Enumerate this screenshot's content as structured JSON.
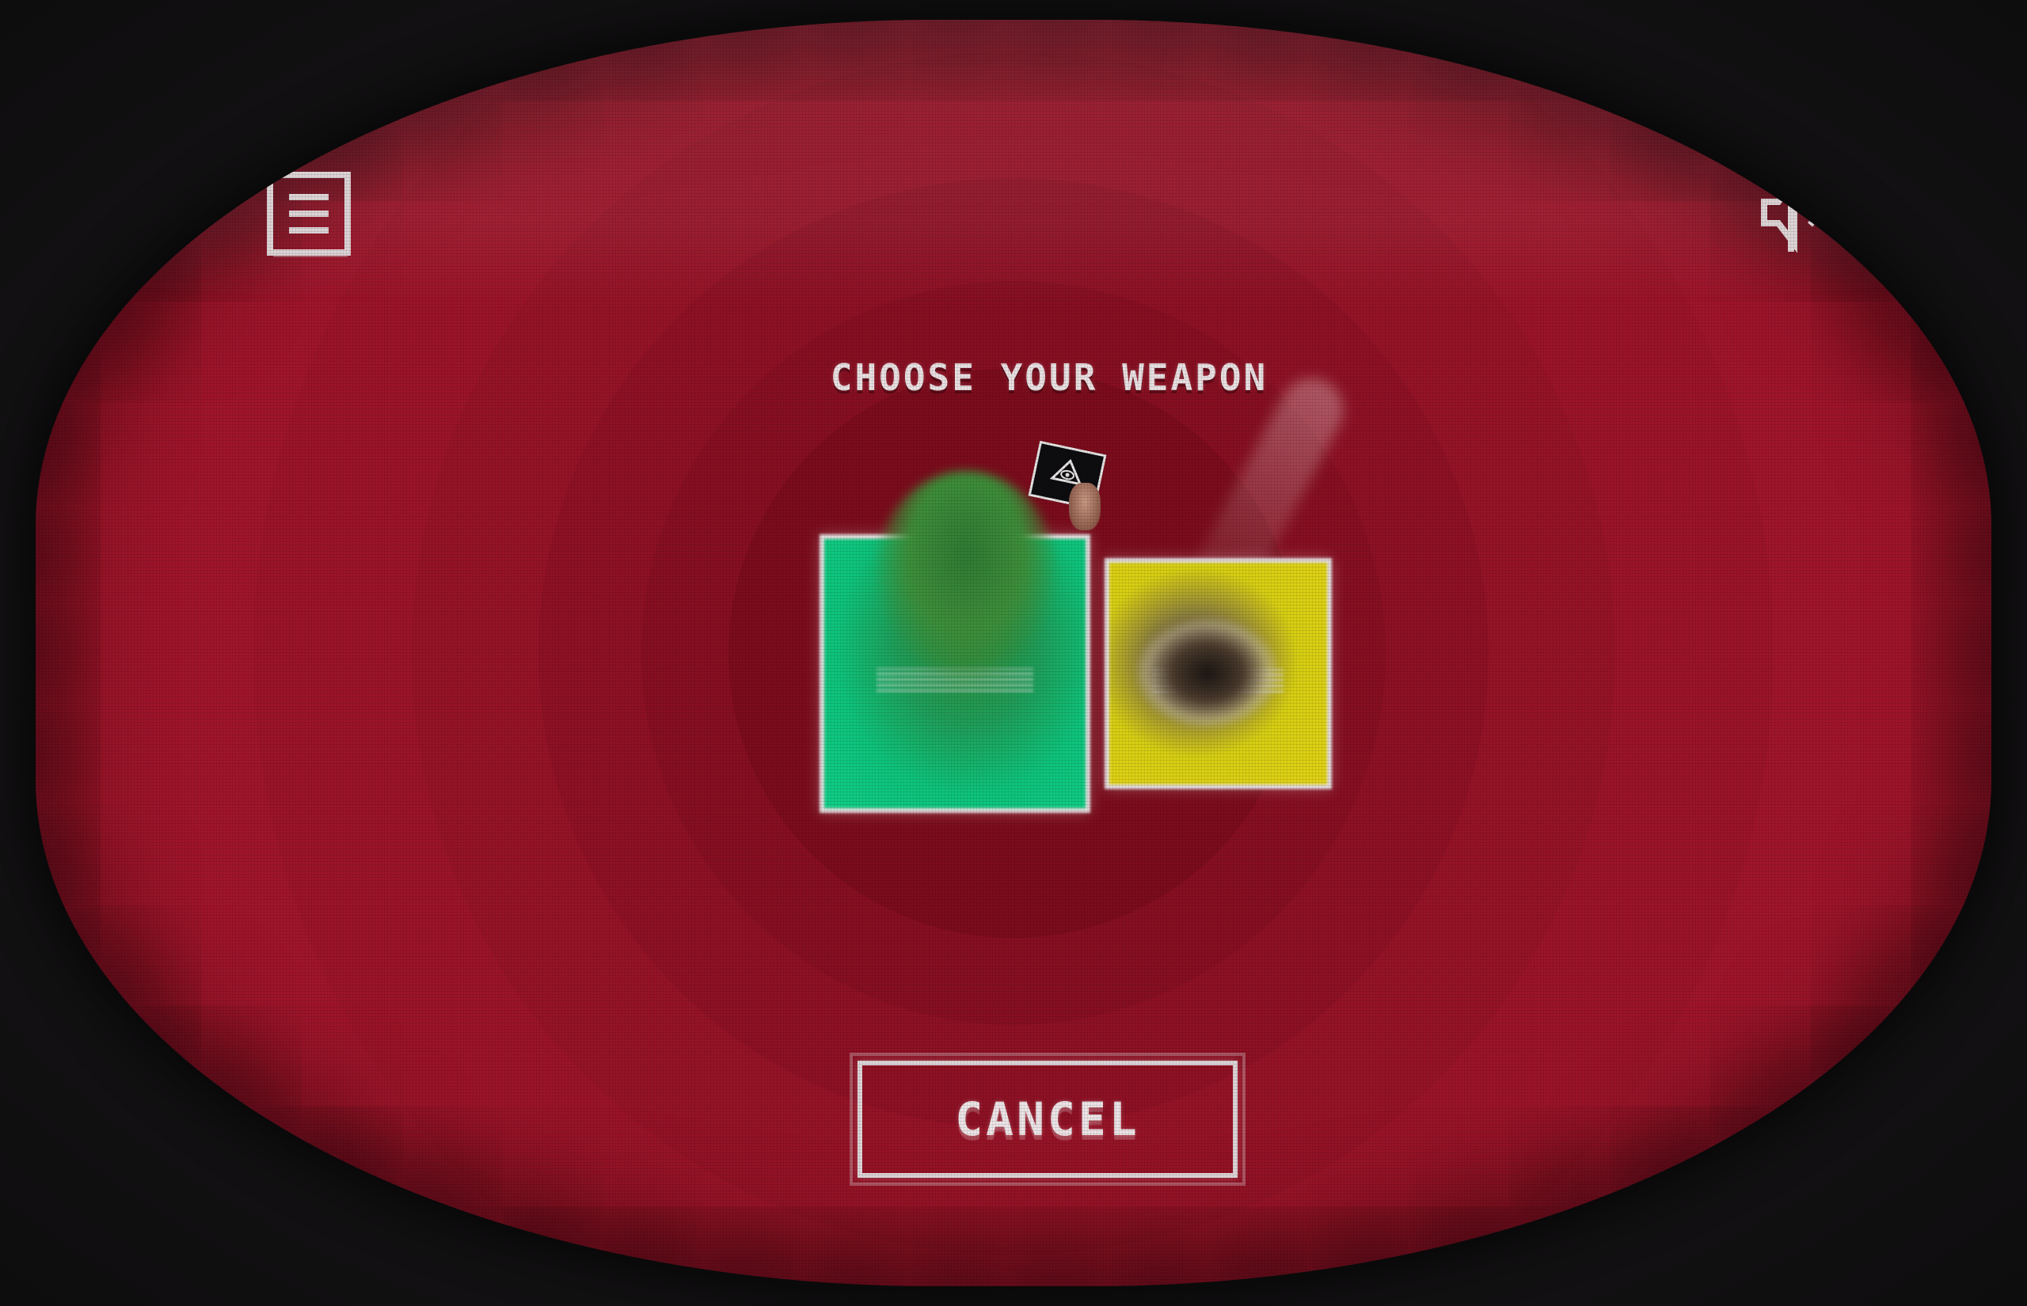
{
  "screen": {
    "title": "CHOOSE YOUR WEAPON",
    "cancel_label": "CANCEL"
  },
  "icons": {
    "menu": "menu-icon",
    "sound": "sound-icon"
  },
  "weapons": [
    {
      "color": "#10cf86",
      "icon": "green-weapon-card"
    },
    {
      "color": "#e2d315",
      "icon": "yellow-weapon-card"
    }
  ],
  "colors": {
    "background": "#a0152a",
    "bezel": "#141214",
    "text": "#e9e0e2"
  }
}
